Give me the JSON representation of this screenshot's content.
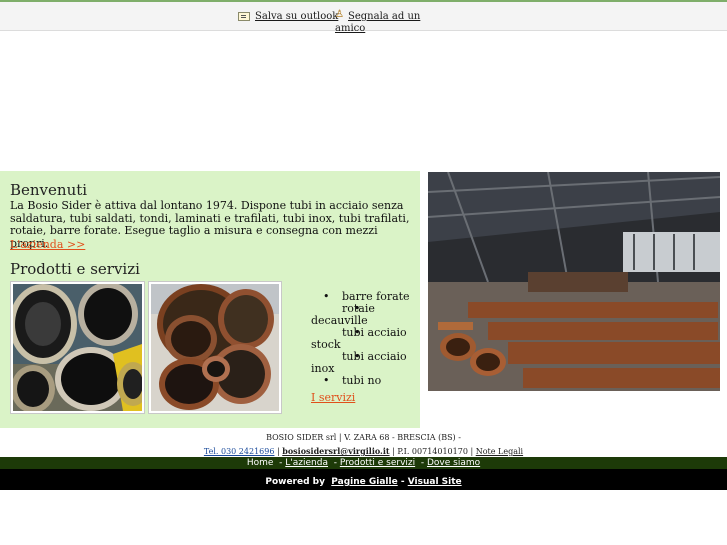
{
  "toolbar": {
    "outlook_label": "Salva su outlook",
    "friend_label_line1": "Segnala ad un",
    "friend_label_line2": "amico",
    "icons": [
      "address-card-icon",
      "user-send-icon"
    ]
  },
  "welcome": {
    "title": "Benvenuti",
    "text": "La Bosio Sider è attiva dal lontano 1974. Dispone tubi in acciaio senza saldatura, tubi saldati, tondi, laminati e trafilati, tubi inox, tubi trafilati, rotaie, barre forate. Esegue taglio a misura e consegna con mezzi propri.",
    "link": "L'azienda >>"
  },
  "products": {
    "title": "Prodotti e servizi",
    "services": [
      "barre forate",
      "rotaie decauville",
      "tubi acciaio stock",
      "tubi acciaio inox",
      "tubi no"
    ],
    "link": "I servizi"
  },
  "footer": {
    "address": "BOSIO SIDER srl | V. ZARA 68 - BRESCIA (BS) -",
    "tel": "Tel. 030 2421696",
    "email": "bosiosidersrl@virgilio.it",
    "vat": "P.I. 00714010170",
    "legal": "Note Legali",
    "sep": "|",
    "nav": [
      "Home",
      "L'azienda",
      "Prodotti e servizi",
      "Dove siamo"
    ],
    "powered_label": "Powered by",
    "powered_a": "Pagine Gialle",
    "powered_b": "Visual Site",
    "powered_dash": "-"
  },
  "colors": {
    "panel_bg": "#daf3c7",
    "link_orange": "#e0501b",
    "nav_bg": "#1d3a08",
    "powered_bg": "#000000"
  }
}
